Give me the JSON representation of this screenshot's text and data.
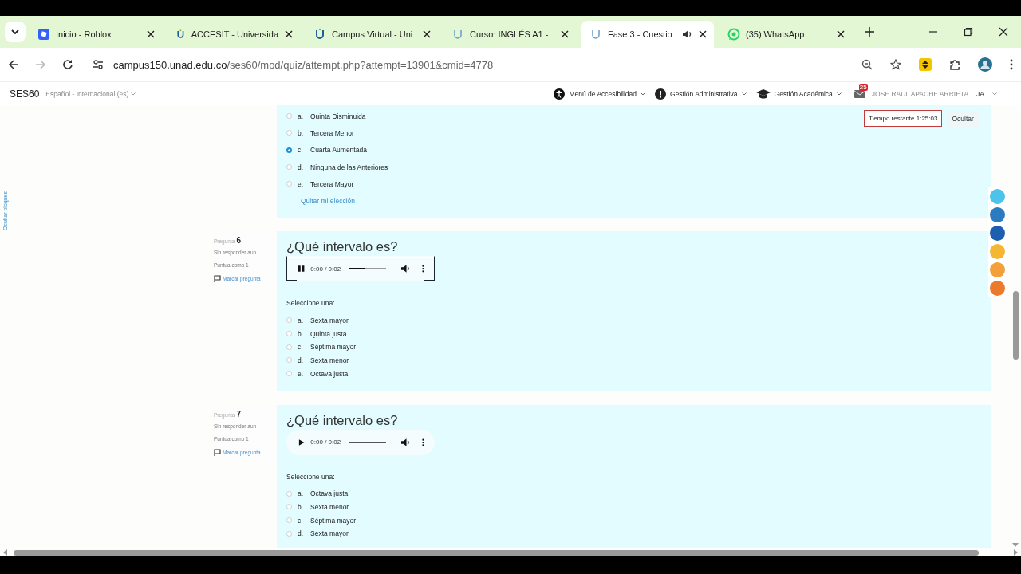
{
  "browser": {
    "tabs": [
      {
        "title": "Inicio - Roblox",
        "kind": "roblox",
        "selected": false,
        "audio": false
      },
      {
        "title": "ACCESIT - Universida",
        "kind": "unad",
        "selected": false,
        "audio": false
      },
      {
        "title": "Campus Virtual - Uni",
        "kind": "unad",
        "selected": false,
        "audio": false
      },
      {
        "title": "Curso: INGLÉS A1 -",
        "kind": "faded",
        "selected": false,
        "audio": false
      },
      {
        "title": "Fase 3 - Cuestio",
        "kind": "faded",
        "selected": true,
        "audio": true
      },
      {
        "title": "(35) WhatsApp",
        "kind": "whatsapp",
        "selected": false,
        "audio": false
      }
    ],
    "address": {
      "host": "campus150.unad.edu.co",
      "path": "/ses60/mod/quiz/attempt.php?attempt=13901&cmid=4778"
    }
  },
  "header": {
    "site": "SES60",
    "language": "Español - Internacional (es)",
    "menus": [
      {
        "label": "Menú de Accesibilidad",
        "kind": "accessibility"
      },
      {
        "label": "Gestión Administrativa",
        "kind": "alert"
      },
      {
        "label": "Gestión Académica",
        "kind": "graduation"
      }
    ],
    "messages_badge": "25",
    "user_name": "JOSE RAUL APACHE ARRIETA",
    "user_initials": "JA"
  },
  "sidebar_toggle": "Ocultar bloques",
  "timer": {
    "label": "Tiempo restante 1:25:03",
    "hide_button": "Ocultar"
  },
  "questions": [
    {
      "options": [
        {
          "letter": "a.",
          "text": "Quinta Disminuida",
          "selected": false
        },
        {
          "letter": "b.",
          "text": "Tercera Menor",
          "selected": false
        },
        {
          "letter": "c.",
          "text": "Cuarta Aumentada",
          "selected": true
        },
        {
          "letter": "d.",
          "text": "Ninguna de las Anteriores",
          "selected": false
        },
        {
          "letter": "e.",
          "text": "Tercera Mayor",
          "selected": false
        }
      ],
      "clear_label": "Quitar mi elección"
    },
    {
      "label": "Pregunta",
      "number": "6",
      "status": "Sin responder aun",
      "grade": "Puntua como 1",
      "flag_label": "Marcar pregunta",
      "title": "¿Qué intervalo es?",
      "audio": {
        "time": "0:00 / 0:02",
        "playing": true,
        "focused": true,
        "level": 0.45
      },
      "prompt": "Seleccione una:",
      "options": [
        {
          "letter": "a.",
          "text": "Sexta mayor",
          "selected": false
        },
        {
          "letter": "b.",
          "text": "Quinta justa",
          "selected": false
        },
        {
          "letter": "c.",
          "text": "Séptima mayor",
          "selected": false
        },
        {
          "letter": "d.",
          "text": "Sexta menor",
          "selected": false
        },
        {
          "letter": "e.",
          "text": "Octava justa",
          "selected": false
        }
      ]
    },
    {
      "label": "Pregunta",
      "number": "7",
      "status": "Sin responder aun",
      "grade": "Puntua como 1",
      "flag_label": "Marcar pregunta",
      "title": "¿Qué intervalo es?",
      "audio": {
        "time": "0:00 / 0:02",
        "playing": false,
        "focused": false,
        "level": 0
      },
      "prompt": "Seleccione una:",
      "options": [
        {
          "letter": "a.",
          "text": "Octava justa",
          "selected": false
        },
        {
          "letter": "b.",
          "text": "Sexta menor",
          "selected": false
        },
        {
          "letter": "c.",
          "text": "Séptima mayor",
          "selected": false
        },
        {
          "letter": "d.",
          "text": "Sexta mayor",
          "selected": false
        }
      ]
    }
  ],
  "side_tools": [
    {
      "color": "#4cc3ea"
    },
    {
      "color": "#2a7bbf"
    },
    {
      "color": "#1c5fb0"
    },
    {
      "color": "#f5b731"
    },
    {
      "color": "#f3a03a"
    },
    {
      "color": "#ec7a2c"
    }
  ]
}
